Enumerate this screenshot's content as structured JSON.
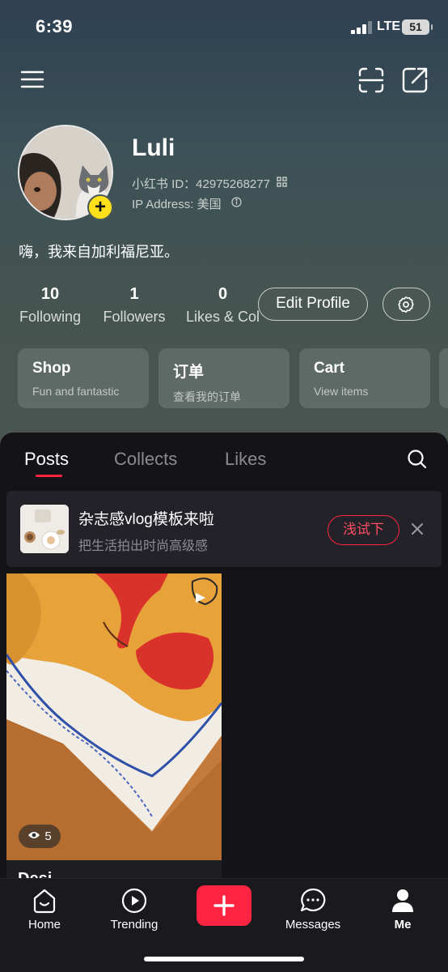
{
  "status_bar": {
    "time": "6:39",
    "network": "LTE",
    "battery": "51"
  },
  "profile": {
    "username": "Luli",
    "id_label": "小红书 ID：42975268277",
    "ip_label": "IP Address: 美国",
    "bio": "嗨，我来自加利福尼亚。"
  },
  "stats": [
    {
      "value": "10",
      "label": "Following"
    },
    {
      "value": "1",
      "label": "Followers"
    },
    {
      "value": "0",
      "label": "Likes & Col"
    }
  ],
  "actions": {
    "edit_profile": "Edit Profile"
  },
  "cards": [
    {
      "title": "Shop",
      "subtitle": "Fun and fantastic"
    },
    {
      "title": "订单",
      "subtitle": "查看我的订单"
    },
    {
      "title": "Cart",
      "subtitle": "View items"
    }
  ],
  "tabs": [
    {
      "label": "Posts",
      "active": true
    },
    {
      "label": "Collects",
      "active": false
    },
    {
      "label": "Likes",
      "active": false
    }
  ],
  "promo": {
    "title": "杂志感vlog模板来啦",
    "subtitle": "把生活拍出时尚高级感",
    "button": "浅试下"
  },
  "post": {
    "views": "5",
    "title": "Desi"
  },
  "bottom_nav": [
    {
      "label": "Home",
      "icon": "home-icon"
    },
    {
      "label": "Trending",
      "icon": "play-circle-icon"
    },
    {
      "label": "",
      "icon": "plus-icon"
    },
    {
      "label": "Messages",
      "icon": "chat-bubble-icon"
    },
    {
      "label": "Me",
      "icon": "person-icon"
    }
  ],
  "colors": {
    "accent": "#ff2442",
    "add_badge": "#ffe01a"
  }
}
